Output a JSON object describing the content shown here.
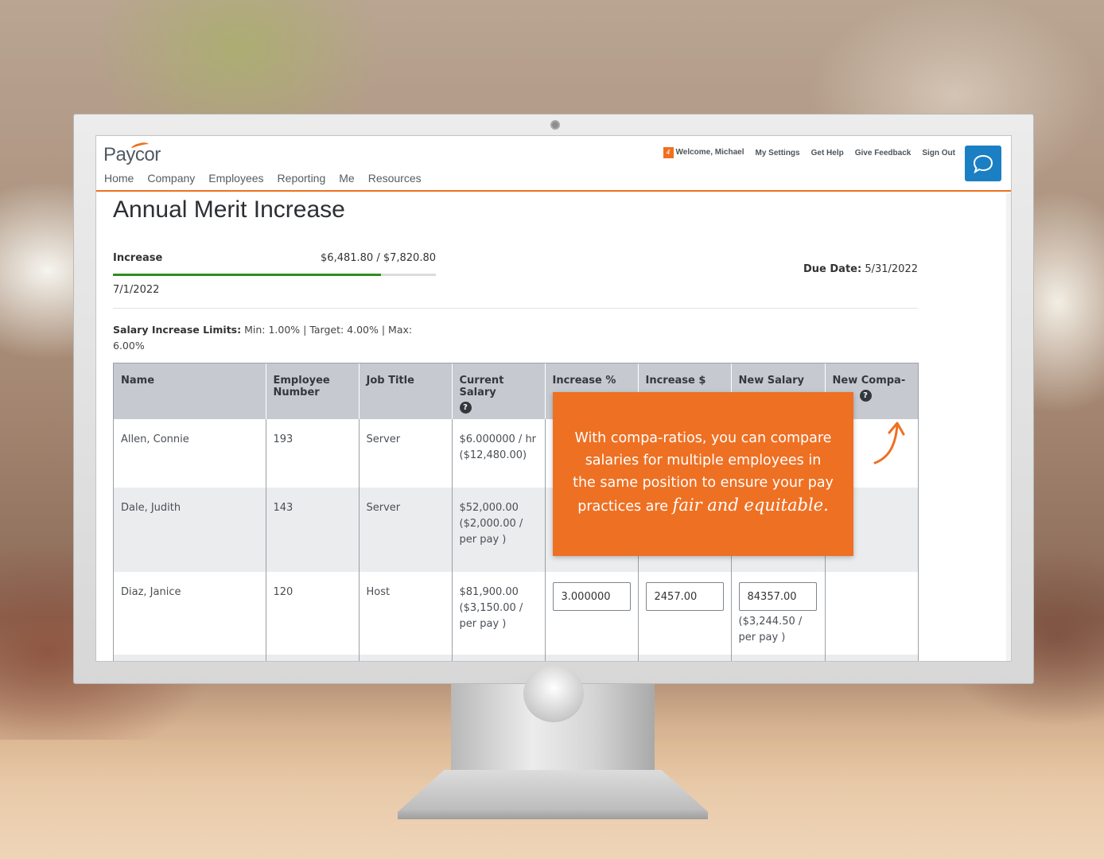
{
  "app": {
    "brand": "Paycor",
    "nav": [
      "Home",
      "Company",
      "Employees",
      "Reporting",
      "Me",
      "Resources"
    ],
    "notification_count": "4",
    "util_links": [
      "Welcome, Michael",
      "My Settings",
      "Get Help",
      "Give Feedback",
      "Sign Out"
    ],
    "accent_color": "#ef7120",
    "chat_color": "#1b7fc4"
  },
  "page": {
    "title": "Annual Merit Increase",
    "increase_label": "Increase",
    "increase_amount": "$6,481.80 / $7,820.80",
    "increase_progress": 0.829,
    "effective_date": "7/1/2022",
    "due_label": "Due Date:",
    "due_value": "5/31/2022",
    "limits_label": "Salary Increase Limits:",
    "limits_value": "Min: 1.00% | Target: 4.00% | Max: 6.00%"
  },
  "table": {
    "headers": [
      "Name",
      "Employee Number",
      "Job Title",
      "Current Salary",
      "Increase %",
      "Increase $",
      "New Salary",
      "New Compa-"
    ],
    "rows": [
      {
        "name": "Allen, Connie",
        "number": "193",
        "title": "Server",
        "salary": "$6.000000 / hr ($12,480.00)"
      },
      {
        "name": "Dale, Judith",
        "number": "143",
        "title": "Server",
        "salary": "$52,000.00 ($2,000.00 / per pay )"
      },
      {
        "name": "Diaz, Janice",
        "number": "120",
        "title": "Host",
        "salary": "$81,900.00 ($3,150.00 / per pay )",
        "increase_pct": "3.000000",
        "increase_amt": "2457.00",
        "new_salary": "84357.00",
        "new_salary_sub": "($3,244.50 / per pay )"
      }
    ]
  },
  "callout": {
    "text": "With compa-ratios, you can compare salaries for multiple employees in the same position to ensure your pay practices are",
    "script_text": "fair and equitable."
  }
}
